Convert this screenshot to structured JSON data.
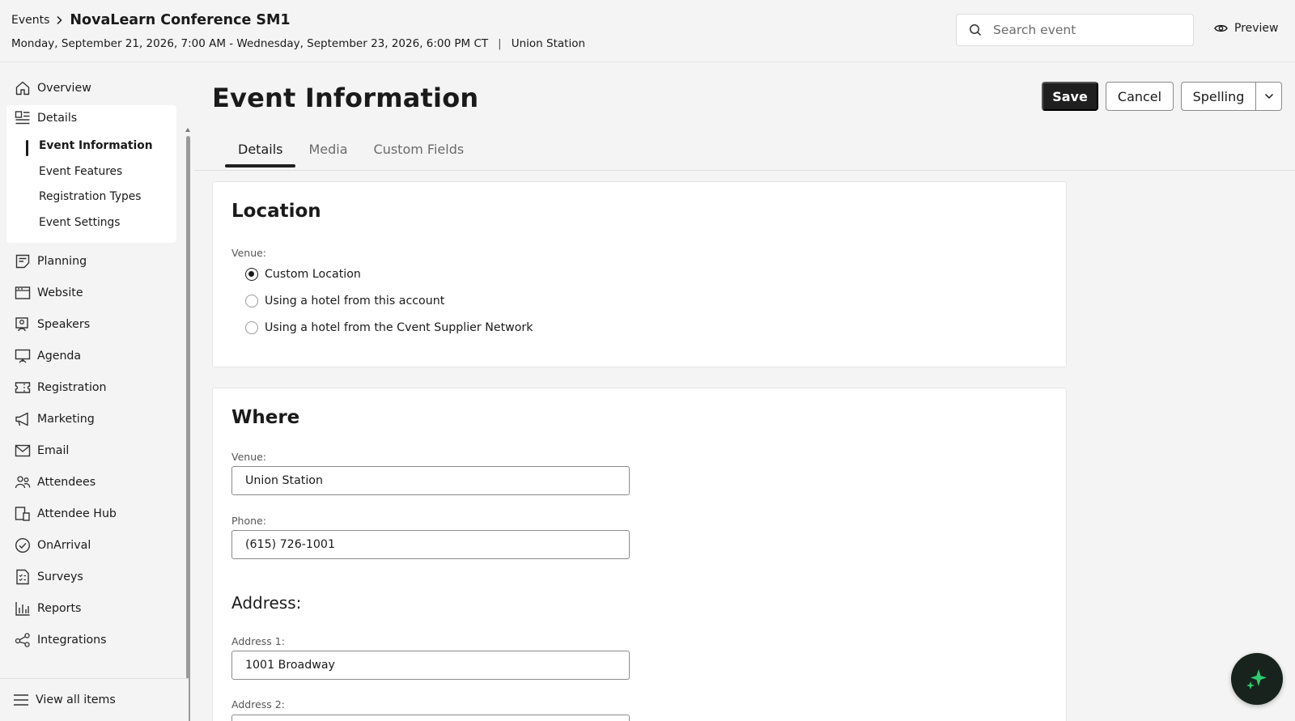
{
  "header": {
    "breadcrumb_root": "Events",
    "event_title": "NovaLearn Conference SM1",
    "date_range": "Monday, September 21, 2026, 7:00 AM - Wednesday, September 23, 2026, 6:00 PM CT",
    "divider": "|",
    "venue": "Union Station",
    "search_placeholder": "Search event",
    "preview_label": "Preview"
  },
  "sidebar": {
    "overview": "Overview",
    "details": "Details",
    "details_sub": [
      "Event Information",
      "Event Features",
      "Registration Types",
      "Event Settings"
    ],
    "items": [
      "Planning",
      "Website",
      "Speakers",
      "Agenda",
      "Registration",
      "Marketing",
      "Email",
      "Attendees",
      "Attendee Hub",
      "OnArrival",
      "Surveys",
      "Reports",
      "Integrations"
    ],
    "view_all": "View all items"
  },
  "main": {
    "page_title": "Event Information",
    "save_label": "Save",
    "cancel_label": "Cancel",
    "spelling_label": "Spelling",
    "tabs": [
      "Details",
      "Media",
      "Custom Fields"
    ],
    "location": {
      "title": "Location",
      "venue_label": "Venue:",
      "options": [
        "Custom Location",
        "Using a hotel from this account",
        "Using a hotel from the Cvent Supplier Network"
      ],
      "selected": "Custom Location"
    },
    "where": {
      "title": "Where",
      "venue_label": "Venue:",
      "venue_value": "Union Station",
      "phone_label": "Phone:",
      "phone_value": "(615) 726-1001",
      "address_heading": "Address:",
      "address1_label": "Address 1:",
      "address1_value": "1001 Broadway",
      "address2_label": "Address 2:"
    }
  },
  "colors": {
    "primary_button": "#1f1f1f",
    "ai_fab_bg": "#17231c",
    "ai_fab_icon": "#2ecc71"
  }
}
